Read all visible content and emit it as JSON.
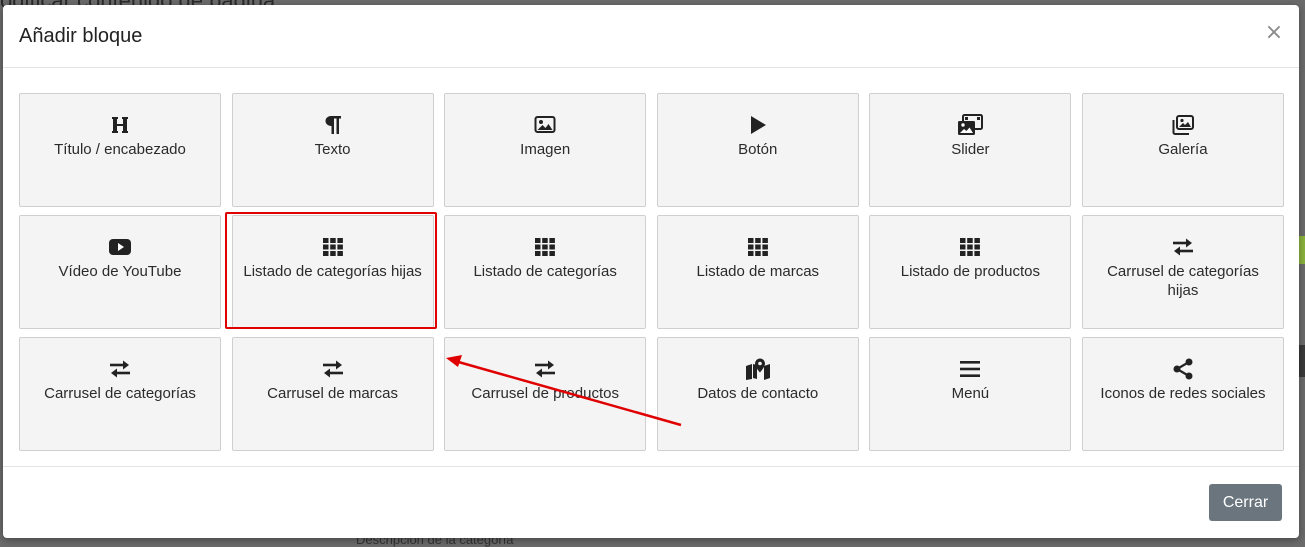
{
  "background": {
    "page_title": "odificar contenido de página",
    "description_label": "Descripción de la categoría"
  },
  "modal": {
    "title": "Añadir bloque",
    "close_symbol": "×",
    "footer": {
      "close_label": "Cerrar"
    }
  },
  "blocks": [
    {
      "label": "Título / encabezado",
      "icon": "heading-icon"
    },
    {
      "label": "Texto",
      "icon": "paragraph-icon"
    },
    {
      "label": "Imagen",
      "icon": "image-icon"
    },
    {
      "label": "Botón",
      "icon": "play-icon"
    },
    {
      "label": "Slider",
      "icon": "photo-film-icon"
    },
    {
      "label": "Galería",
      "icon": "images-icon"
    },
    {
      "label": "Vídeo de YouTube",
      "icon": "youtube-icon"
    },
    {
      "label": "Listado de categorías hijas",
      "icon": "grid-icon",
      "highlighted": true
    },
    {
      "label": "Listado de categorías",
      "icon": "grid-icon"
    },
    {
      "label": "Listado de marcas",
      "icon": "grid-icon"
    },
    {
      "label": "Listado de productos",
      "icon": "grid-icon"
    },
    {
      "label": "Carrusel de categorías hijas",
      "icon": "arrows-exchange-icon"
    },
    {
      "label": "Carrusel de categorías",
      "icon": "arrows-exchange-icon"
    },
    {
      "label": "Carrusel de marcas",
      "icon": "arrows-exchange-icon"
    },
    {
      "label": "Carrusel de productos",
      "icon": "arrows-exchange-icon"
    },
    {
      "label": "Datos de contacto",
      "icon": "map-location-icon"
    },
    {
      "label": "Menú",
      "icon": "menu-bars-icon"
    },
    {
      "label": "Iconos de redes sociales",
      "icon": "share-icon"
    }
  ],
  "annotation": {
    "color": "#e00000"
  },
  "colors": {
    "tile_bg": "#f4f4f4",
    "button_bg": "#6b757d"
  }
}
